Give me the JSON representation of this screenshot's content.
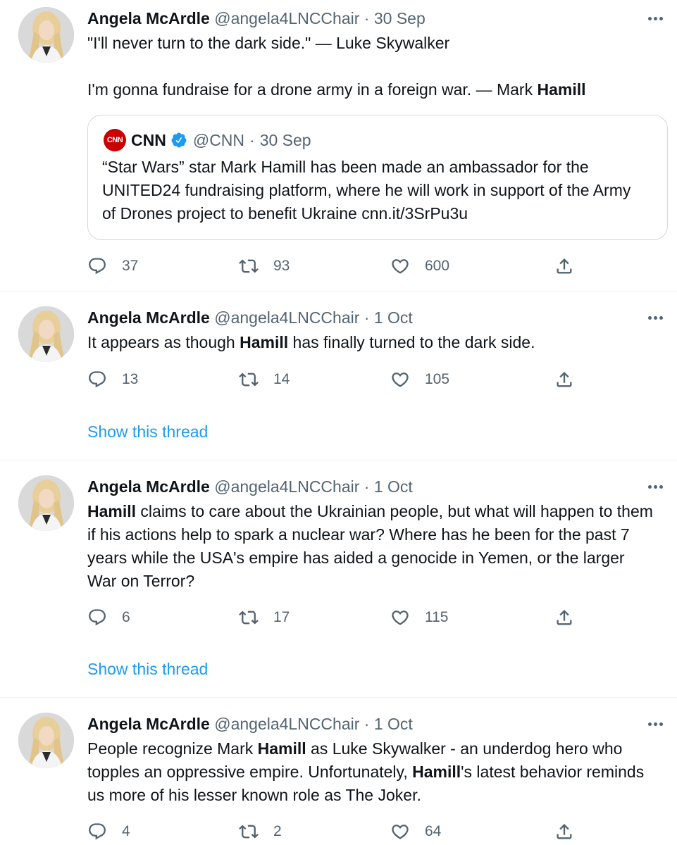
{
  "tweets": [
    {
      "name": "Angela McArdle",
      "handle": "@angela4LNCChair",
      "sep": "·",
      "time": "30 Sep",
      "paragraphs": [
        [
          {
            "t": "\"I'll never turn to the dark side.\" — Luke Skywalker",
            "b": false
          }
        ],
        [
          {
            "t": "I'm gonna fundraise for a drone army in a foreign war. — Mark ",
            "b": false
          },
          {
            "t": "Hamill",
            "b": true
          }
        ]
      ],
      "quote": {
        "logo_text": "CNN",
        "name": "CNN",
        "handle": "@CNN",
        "sep": "·",
        "time": "30 Sep",
        "text": "“Star Wars” star Mark Hamill has been made an ambassador for the UNITED24 fundraising platform, where he will work in support of the Army of Drones project to benefit Ukraine cnn.it/3SrPu3u"
      },
      "replies": "37",
      "retweets": "93",
      "likes": "600",
      "show_thread": ""
    },
    {
      "name": "Angela McArdle",
      "handle": "@angela4LNCChair",
      "sep": "·",
      "time": "1 Oct",
      "paragraphs": [
        [
          {
            "t": "It appears as though ",
            "b": false
          },
          {
            "t": "Hamill",
            "b": true
          },
          {
            "t": " has finally turned to the dark side.",
            "b": false
          }
        ]
      ],
      "replies": "13",
      "retweets": "14",
      "likes": "105",
      "show_thread": "Show this thread"
    },
    {
      "name": "Angela McArdle",
      "handle": "@angela4LNCChair",
      "sep": "·",
      "time": "1 Oct",
      "paragraphs": [
        [
          {
            "t": "Hamill",
            "b": true
          },
          {
            "t": " claims to care about the Ukrainian people, but what will happen to them if his actions help to spark a nuclear war? Where has he been for the past 7 years while the USA's empire has aided a genocide in Yemen, or the larger War on Terror?",
            "b": false
          }
        ]
      ],
      "replies": "6",
      "retweets": "17",
      "likes": "115",
      "show_thread": "Show this thread"
    },
    {
      "name": "Angela McArdle",
      "handle": "@angela4LNCChair",
      "sep": "·",
      "time": "1 Oct",
      "paragraphs": [
        [
          {
            "t": "People recognize Mark ",
            "b": false
          },
          {
            "t": "Hamill",
            "b": true
          },
          {
            "t": " as Luke Skywalker - an underdog hero who topples an oppressive empire. Unfortunately, ",
            "b": false
          },
          {
            "t": "Hamill",
            "b": true
          },
          {
            "t": "'s latest behavior reminds us more of his lesser known role as The Joker.",
            "b": false
          }
        ]
      ],
      "replies": "4",
      "retweets": "2",
      "likes": "64",
      "show_thread": ""
    }
  ],
  "colors": {
    "text": "#0f1419",
    "secondary": "#536471",
    "link": "#1d9bf0",
    "verified": "#1d9bf0",
    "cnn_red": "#cc0000",
    "border": "#cfd9de"
  }
}
